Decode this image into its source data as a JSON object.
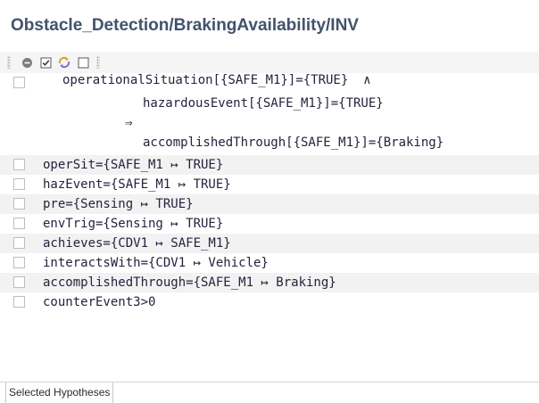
{
  "title": "Obstacle_Detection/BrakingAvailability/INV",
  "toolbar": {
    "icons": [
      "remove-icon",
      "checked-box-icon",
      "refresh-icon",
      "empty-box-icon"
    ]
  },
  "goal": {
    "line1": "operationalSituation[{SAFE_M1}]={TRUE}  ∧",
    "line2": "hazardousEvent[{SAFE_M1}]={TRUE}",
    "arrow": "⇒",
    "line3": "accomplishedThrough[{SAFE_M1}]={Braking}"
  },
  "hypotheses": [
    "operSit={SAFE_M1 ↦ TRUE}",
    "hazEvent={SAFE_M1 ↦ TRUE}",
    "pre={Sensing ↦ TRUE}",
    "envTrig={Sensing ↦ TRUE}",
    "achieves={CDV1 ↦ SAFE_M1}",
    "interactsWith={CDV1 ↦ Vehicle}",
    "accomplishedThrough={SAFE_M1 ↦ Braking}",
    "counterEvent3>0"
  ],
  "status": {
    "tab_label": "Selected Hypotheses"
  },
  "colors": {
    "title": "#42536b",
    "text": "#23233f",
    "row_shade": "#f2f2f2"
  }
}
